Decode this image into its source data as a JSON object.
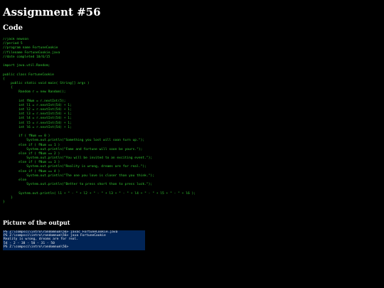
{
  "page": {
    "title": "Assignment #56",
    "code_heading": "Code",
    "output_heading": "Picture of the output"
  },
  "code": {
    "lines": [
      "//jack newson",
      "//period 5",
      "//program name FortuneCookie",
      "//filename FortuneCookie.java",
      "//date completed 10/6/15",
      "",
      "import java.util.Random;",
      "",
      "public class FortuneCookie",
      "{",
      "    public static void main( String[] args )",
      "    {",
      "        Random r = new Random();",
      "",
      "        int fNum = r.nextInt(5);",
      "        int l1 = r.nextInt(54) + 1;",
      "        int l2 = r.nextInt(54) + 1;",
      "        int l3 = r.nextInt(54) + 1;",
      "        int l4 = r.nextInt(54) + 1;",
      "        int l5 = r.nextInt(54) + 1;",
      "        int l6 = r.nextInt(54) + 1;",
      "",
      "        if ( fNum == 0 )",
      "            System.out.println(\"Something you lost will soon turn up.\");",
      "        else if ( fNum == 1 )",
      "            System.out.println(\"Fame and fortune will soon be yours.\");",
      "        else if ( fNum == 2 )",
      "            System.out.println(\"You will be invited to an exciting event.\");",
      "        else if ( fNum == 3 )",
      "            System.out.println(\"Reality is wrong, dreams are for real.\");",
      "        else if ( fNum == 4 )",
      "            System.out.println(\"The one you love is closer than you think.\");",
      "        else",
      "            System.out.println(\"Better to press short than to press luck.\");",
      "",
      "        System.out.println( l1 + \" - \" + l2 + \" - \" + l3 + \" - \" + l4 + \" - \" + l5 + \" - \" + l6 );",
      "    }",
      "}"
    ]
  },
  "console": {
    "background": "#012456",
    "lines": [
      "PS Z:\\compsci\\intro\\randomnum\\56> javac FortuneCookie.java",
      "PS Z:\\compsci\\intro\\randomnum\\56> java FortuneCookie",
      "Reality is wrong, dreams are for real.",
      "54 - 2 - 38 - 50 - 31 - 50",
      "PS Z:\\compsci\\intro\\randomnum\\56>"
    ]
  },
  "colors": {
    "page_background": "#000000",
    "heading_text": "#ffffff",
    "code_text": "#33cc33",
    "console_text": "#eeedf0"
  }
}
